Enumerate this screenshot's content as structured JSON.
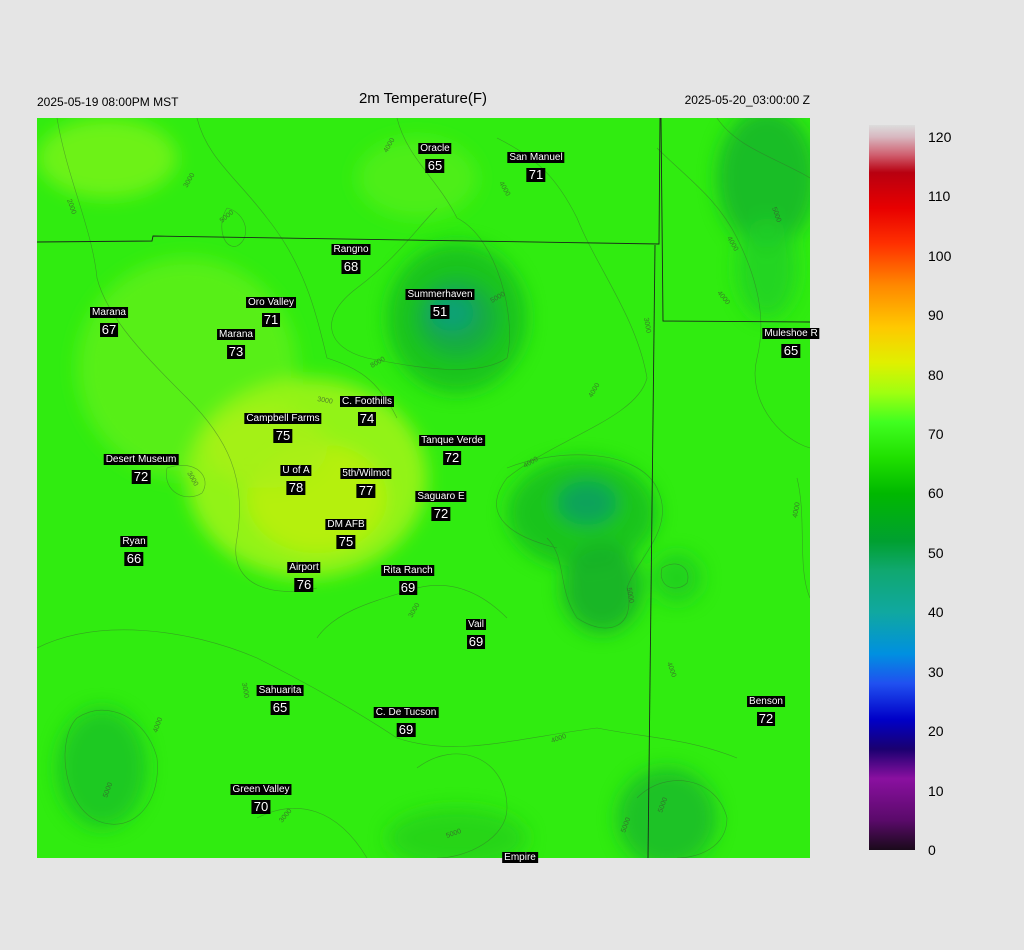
{
  "header": {
    "local_time": "2025-05-19 08:00PM MST",
    "title": "2m Temperature(F)",
    "utc_time": "2025-05-20_03:00:00 Z"
  },
  "stations": [
    {
      "name": "Oracle",
      "value": "65"
    },
    {
      "name": "San Manuel",
      "value": "71"
    },
    {
      "name": "Rangno",
      "value": "68"
    },
    {
      "name": "Summerhaven",
      "value": "51"
    },
    {
      "name": "Marana",
      "value": "67"
    },
    {
      "name": "Oro Valley",
      "value": "71"
    },
    {
      "name": "Marana",
      "value": "73"
    },
    {
      "name": "Muleshoe R",
      "value": "65"
    },
    {
      "name": "C. Foothills",
      "value": "74"
    },
    {
      "name": "Campbell Farms",
      "value": "75"
    },
    {
      "name": "Tanque Verde",
      "value": "72"
    },
    {
      "name": "Desert Museum",
      "value": "72"
    },
    {
      "name": "U of A",
      "value": "78"
    },
    {
      "name": "5th/Wilmot",
      "value": "77"
    },
    {
      "name": "Saguaro E",
      "value": "72"
    },
    {
      "name": "DM AFB",
      "value": "75"
    },
    {
      "name": "Ryan",
      "value": "66"
    },
    {
      "name": "Airport",
      "value": "76"
    },
    {
      "name": "Rita Ranch",
      "value": "69"
    },
    {
      "name": "Vail",
      "value": "69"
    },
    {
      "name": "Sahuarita",
      "value": "65"
    },
    {
      "name": "C. De Tucson",
      "value": "69"
    },
    {
      "name": "Benson",
      "value": "72"
    },
    {
      "name": "Green Valley",
      "value": "70"
    },
    {
      "name": "Empire",
      "value": ""
    }
  ],
  "contour_labels": [
    "2000",
    "3000",
    "4000",
    "5000",
    "6000",
    "8000"
  ],
  "colorbar": {
    "min": 0,
    "max": 122,
    "labels": [
      "120",
      "110",
      "100",
      "90",
      "80",
      "70",
      "60",
      "50",
      "40",
      "30",
      "20",
      "10",
      "0"
    ],
    "stops": [
      {
        "t": 0,
        "color": "#1a0a1a"
      },
      {
        "t": 5,
        "color": "#5a0a6a"
      },
      {
        "t": 12,
        "color": "#8a10a0"
      },
      {
        "t": 17,
        "color": "#1a0070"
      },
      {
        "t": 22,
        "color": "#0000c8"
      },
      {
        "t": 28,
        "color": "#2050f0"
      },
      {
        "t": 33,
        "color": "#0090e0"
      },
      {
        "t": 40,
        "color": "#10a8a0"
      },
      {
        "t": 47,
        "color": "#10a870"
      },
      {
        "t": 52,
        "color": "#00a030"
      },
      {
        "t": 60,
        "color": "#00b800"
      },
      {
        "t": 66,
        "color": "#20e000"
      },
      {
        "t": 72,
        "color": "#40ff20"
      },
      {
        "t": 77,
        "color": "#a0ff10"
      },
      {
        "t": 82,
        "color": "#e0f000"
      },
      {
        "t": 88,
        "color": "#ffc800"
      },
      {
        "t": 95,
        "color": "#ff8800"
      },
      {
        "t": 102,
        "color": "#ff3000"
      },
      {
        "t": 108,
        "color": "#e80000"
      },
      {
        "t": 114,
        "color": "#b80010"
      },
      {
        "t": 117,
        "color": "#d06070"
      },
      {
        "t": 120,
        "color": "#d8b8c0"
      },
      {
        "t": 122,
        "color": "#dcdcdc"
      }
    ]
  }
}
